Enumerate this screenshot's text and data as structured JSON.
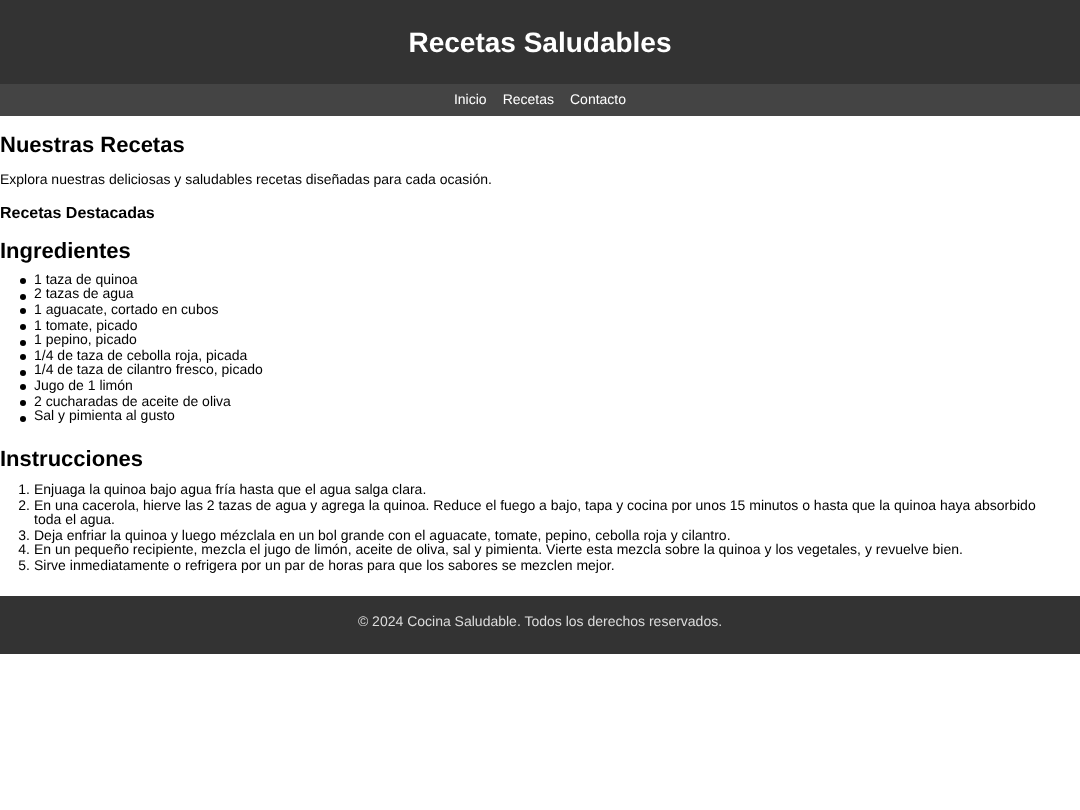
{
  "header": {
    "title": "Recetas Saludables"
  },
  "nav": {
    "links": [
      "Inicio",
      "Recetas",
      "Contacto"
    ]
  },
  "intro": {
    "heading": "Nuestras Recetas",
    "text": "Explora nuestras deliciosas y saludables recetas diseñadas para cada ocasión.",
    "subheading": "Recetas Destacadas"
  },
  "ingredients": {
    "heading": "Ingredientes",
    "items": [
      "1 taza de quinoa",
      "2 tazas de agua",
      "1 aguacate, cortado en cubos",
      "1 tomate, picado",
      "1 pepino, picado",
      "1/4 de taza de cebolla roja, picada",
      "1/4 de taza de cilantro fresco, picado",
      "Jugo de 1 limón",
      "2 cucharadas de aceite de oliva",
      "Sal y pimienta al gusto"
    ]
  },
  "instructions": {
    "heading": "Instrucciones",
    "steps": [
      {
        "number": "1.",
        "text": "Enjuaga la quinoa bajo agua fría hasta que el agua salga clara."
      },
      {
        "number": "2.",
        "text": "En una cacerola, hierve las 2 tazas de agua y agrega la quinoa. Reduce el fuego a bajo, tapa y cocina por unos 15 minutos o hasta que la quinoa haya absorbido toda el agua."
      },
      {
        "number": "3.",
        "text": "Deja enfriar la quinoa y luego mézclala en un bol grande con el aguacate, tomate, pepino, cebolla roja y cilantro."
      },
      {
        "number": "4.",
        "text": "En un pequeño recipiente, mezcla el jugo de limón, aceite de oliva, sal y pimienta. Vierte esta mezcla sobre la quinoa y los vegetales, y revuelve bien."
      },
      {
        "number": "5.",
        "text": "Sirve inmediatamente o refrigera por un par de horas para que los sabores se mezclen mejor."
      }
    ]
  },
  "footer": {
    "text": "© 2024 Cocina Saludable. Todos los derechos reservados."
  }
}
